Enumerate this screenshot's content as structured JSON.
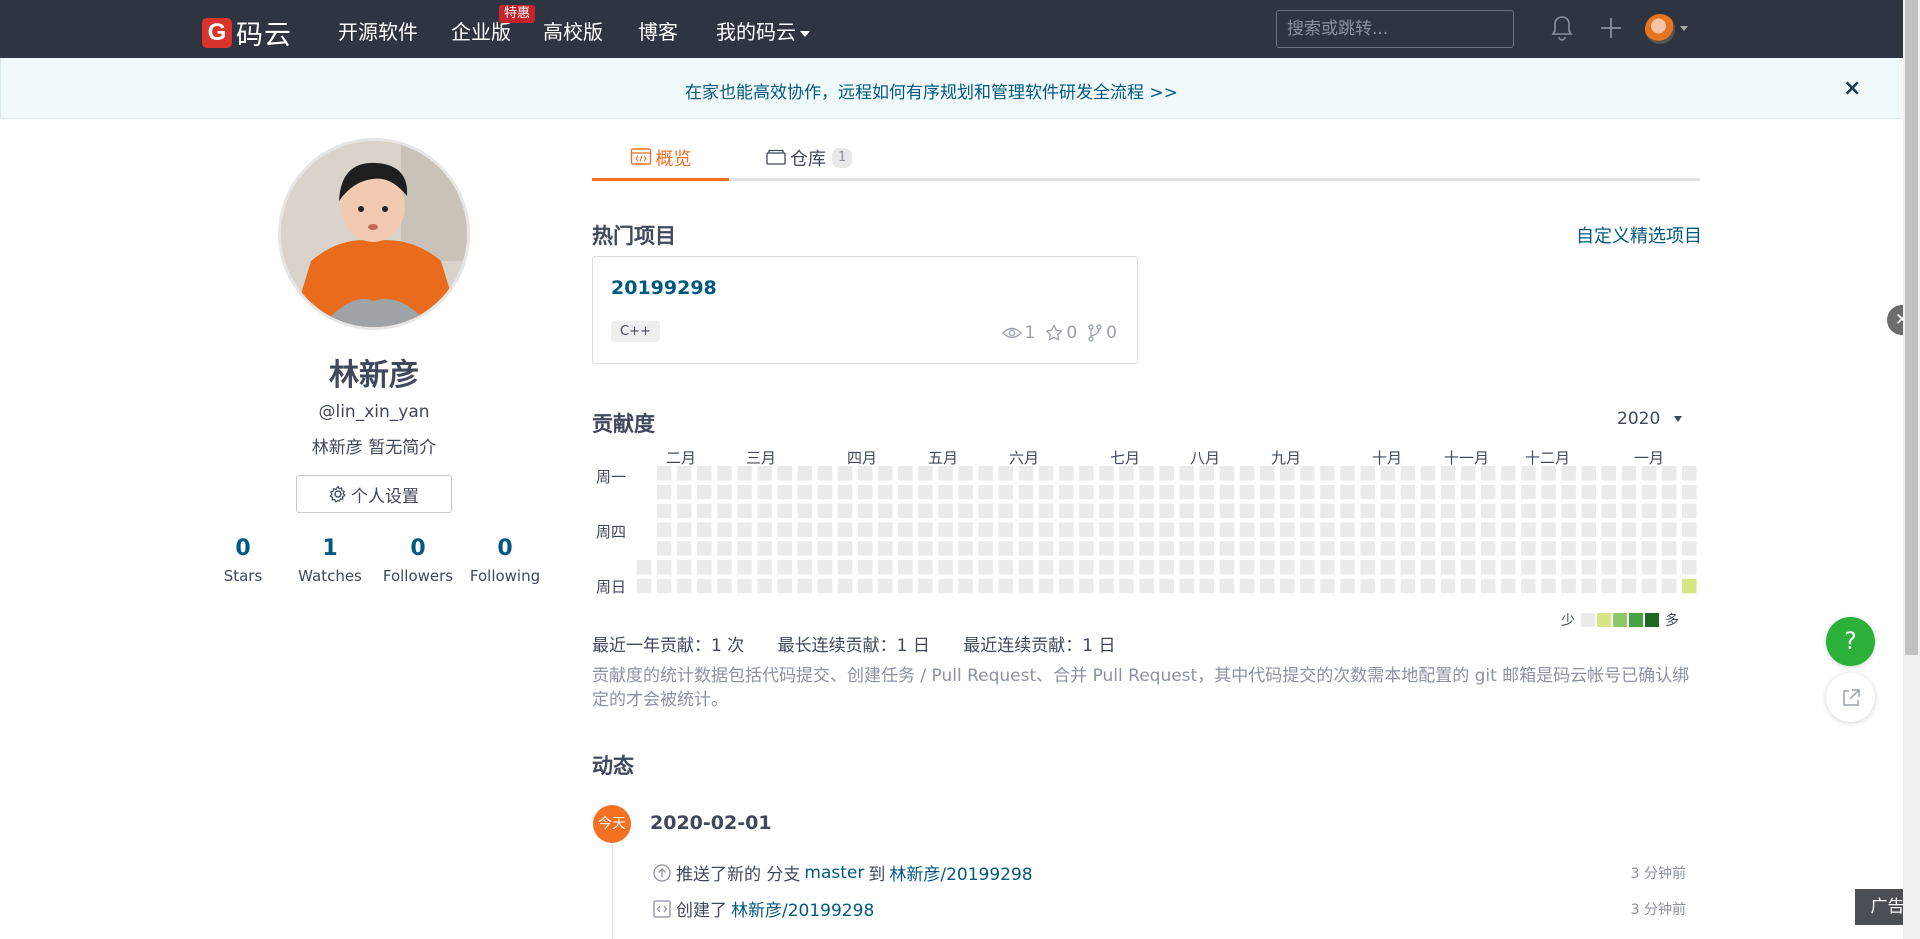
{
  "nav": {
    "logo_text": "码云",
    "items": [
      "开源软件",
      "企业版",
      "高校版",
      "博客",
      "我的码云"
    ],
    "enterprise_badge": "特惠",
    "search_placeholder": "搜索或跳转..."
  },
  "banner": {
    "text": "在家也能高效协作，远程如何有序规划和管理软件研发全流程 >>",
    "close": "×"
  },
  "profile": {
    "name": "林新彦",
    "handle": "@lin_xin_yan",
    "bio": "林新彦 暂无简介",
    "settings_label": "个人设置",
    "stats": [
      {
        "value": "0",
        "label": "Stars"
      },
      {
        "value": "1",
        "label": "Watches"
      },
      {
        "value": "0",
        "label": "Followers"
      },
      {
        "value": "0",
        "label": "Following"
      }
    ]
  },
  "tabs": {
    "overview": "概览",
    "repos": "仓库",
    "repos_count": "1"
  },
  "hot_projects": {
    "title": "热门项目",
    "custom_link": "自定义精选项目",
    "project": {
      "name": "20199298",
      "language": "C++",
      "watches": "1",
      "stars": "0",
      "forks": "0"
    }
  },
  "contribution": {
    "title": "贡献度",
    "year": "2020",
    "months": [
      "二月",
      "三月",
      "四月",
      "五月",
      "六月",
      "七月",
      "八月",
      "九月",
      "十月",
      "十一月",
      "十二月",
      "一月"
    ],
    "days": [
      "周一",
      "周四",
      "周日"
    ],
    "legend_less": "少",
    "legend_more": "多",
    "levels": [
      "#ebebeb",
      "#d6e685",
      "#8cc665",
      "#44a340",
      "#1e6823"
    ],
    "active_cell": {
      "week_from_end": 0,
      "weekday": 6,
      "level": 1
    },
    "summary": {
      "yearly": "最近一年贡献：1 次",
      "longest": "最长连续贡献：1 日",
      "recent": "最近连续贡献：1 日"
    },
    "note": "贡献度的统计数据包括代码提交、创建任务 / Pull Request、合并 Pull Request，其中代码提交的次数需本地配置的 git 邮箱是码云帐号已确认绑定的才会被统计。"
  },
  "activity": {
    "title": "动态",
    "today": "今天",
    "date": "2020-02-01",
    "items": [
      {
        "text1": "推送了新的 分支",
        "link1": "master",
        "text2": "到",
        "link2": "林新彦/20199298",
        "time": "3 分钟前"
      },
      {
        "text1": "创建了",
        "link1": "林新彦/20199298",
        "time": "3 分钟前"
      }
    ]
  },
  "floaters": {
    "help": "?",
    "ad": "广告"
  }
}
